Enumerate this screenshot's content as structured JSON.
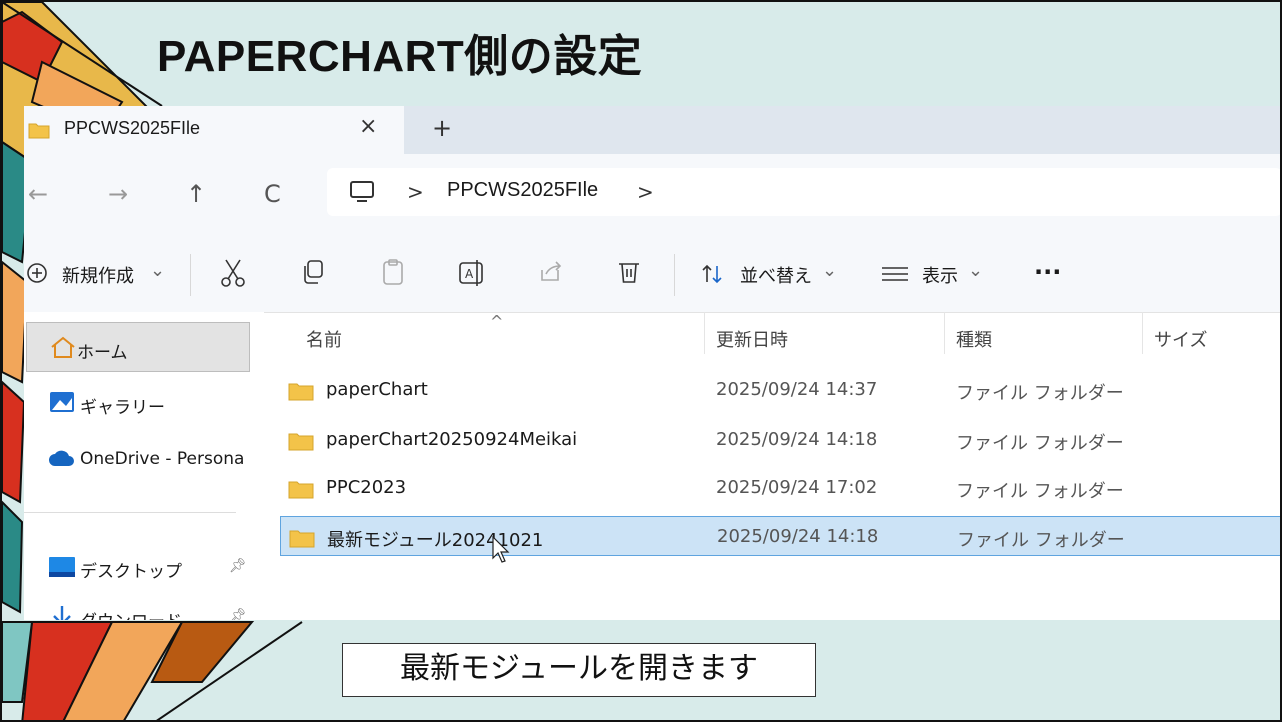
{
  "slide": {
    "title": "PAPERCHART側の設定",
    "caption": "最新モジュールを開きます"
  },
  "window": {
    "tab": {
      "title": "PPCWS2025FIle",
      "close": "×",
      "new": "+"
    },
    "nav": {
      "back": "←",
      "forward": "→",
      "up": "↑",
      "refresh": "C"
    },
    "address": {
      "sep": ">",
      "path": "PPCWS2025FIle"
    },
    "toolbar": {
      "new_label": "新規作成",
      "sort_label": "並べ替え",
      "view_label": "表示",
      "more": "···",
      "caret": "⌄"
    },
    "sidebar": {
      "items": [
        {
          "label": "ホーム"
        },
        {
          "label": "ギャラリー"
        },
        {
          "label": "OneDrive - Persona"
        },
        {
          "label": "デスクトップ"
        },
        {
          "label": "ダウンロード"
        }
      ]
    },
    "list": {
      "columns": [
        "名前",
        "更新日時",
        "種類",
        "サイズ"
      ],
      "rows": [
        {
          "name": "paperChart",
          "date": "2025/09/24 14:37",
          "type": "ファイル フォルダー"
        },
        {
          "name": "paperChart20250924Meikai",
          "date": "2025/09/24 14:18",
          "type": "ファイル フォルダー"
        },
        {
          "name": "PPC2023",
          "date": "2025/09/24 17:02",
          "type": "ファイル フォルダー"
        },
        {
          "name": "最新モジュール20241021",
          "date": "2025/09/24 14:18",
          "type": "ファイル フォルダー"
        }
      ]
    }
  },
  "colors": {
    "background": "#d8ebea",
    "selection": "#cce3f6",
    "folder": "#f3c349"
  }
}
